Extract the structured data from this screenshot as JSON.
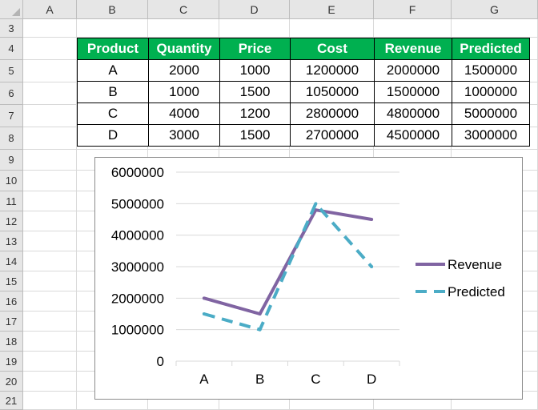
{
  "columns": [
    "A",
    "B",
    "C",
    "D",
    "E",
    "F",
    "G"
  ],
  "rows": [
    "3",
    "4",
    "5",
    "6",
    "7",
    "8",
    "9",
    "10",
    "11",
    "12",
    "13",
    "14",
    "15",
    "16",
    "17",
    "18",
    "19",
    "20",
    "21"
  ],
  "table": {
    "headers": [
      "Product",
      "Quantity",
      "Price",
      "Cost",
      "Revenue",
      "Predicted"
    ],
    "rows": [
      [
        "A",
        "2000",
        "1000",
        "1200000",
        "2000000",
        "1500000"
      ],
      [
        "B",
        "1000",
        "1500",
        "1050000",
        "1500000",
        "1000000"
      ],
      [
        "C",
        "4000",
        "1200",
        "2800000",
        "4800000",
        "5000000"
      ],
      [
        "D",
        "3000",
        "1500",
        "2700000",
        "4500000",
        "3000000"
      ]
    ],
    "header_bg": "#00b050",
    "header_fg": "#ffffff"
  },
  "chart_data": {
    "type": "line",
    "categories": [
      "A",
      "B",
      "C",
      "D"
    ],
    "series": [
      {
        "name": "Revenue",
        "values": [
          2000000,
          1500000,
          4800000,
          4500000
        ],
        "color": "#8064a2",
        "dash": "solid"
      },
      {
        "name": "Predicted",
        "values": [
          1500000,
          1000000,
          5000000,
          3000000
        ],
        "color": "#4bacc6",
        "dash": "dashed"
      }
    ],
    "ylim": [
      0,
      6000000
    ],
    "yticks": [
      "0",
      "1000000",
      "2000000",
      "3000000",
      "4000000",
      "5000000",
      "6000000"
    ],
    "grid": true,
    "legend": "right",
    "title": "",
    "xlabel": "",
    "ylabel": ""
  }
}
